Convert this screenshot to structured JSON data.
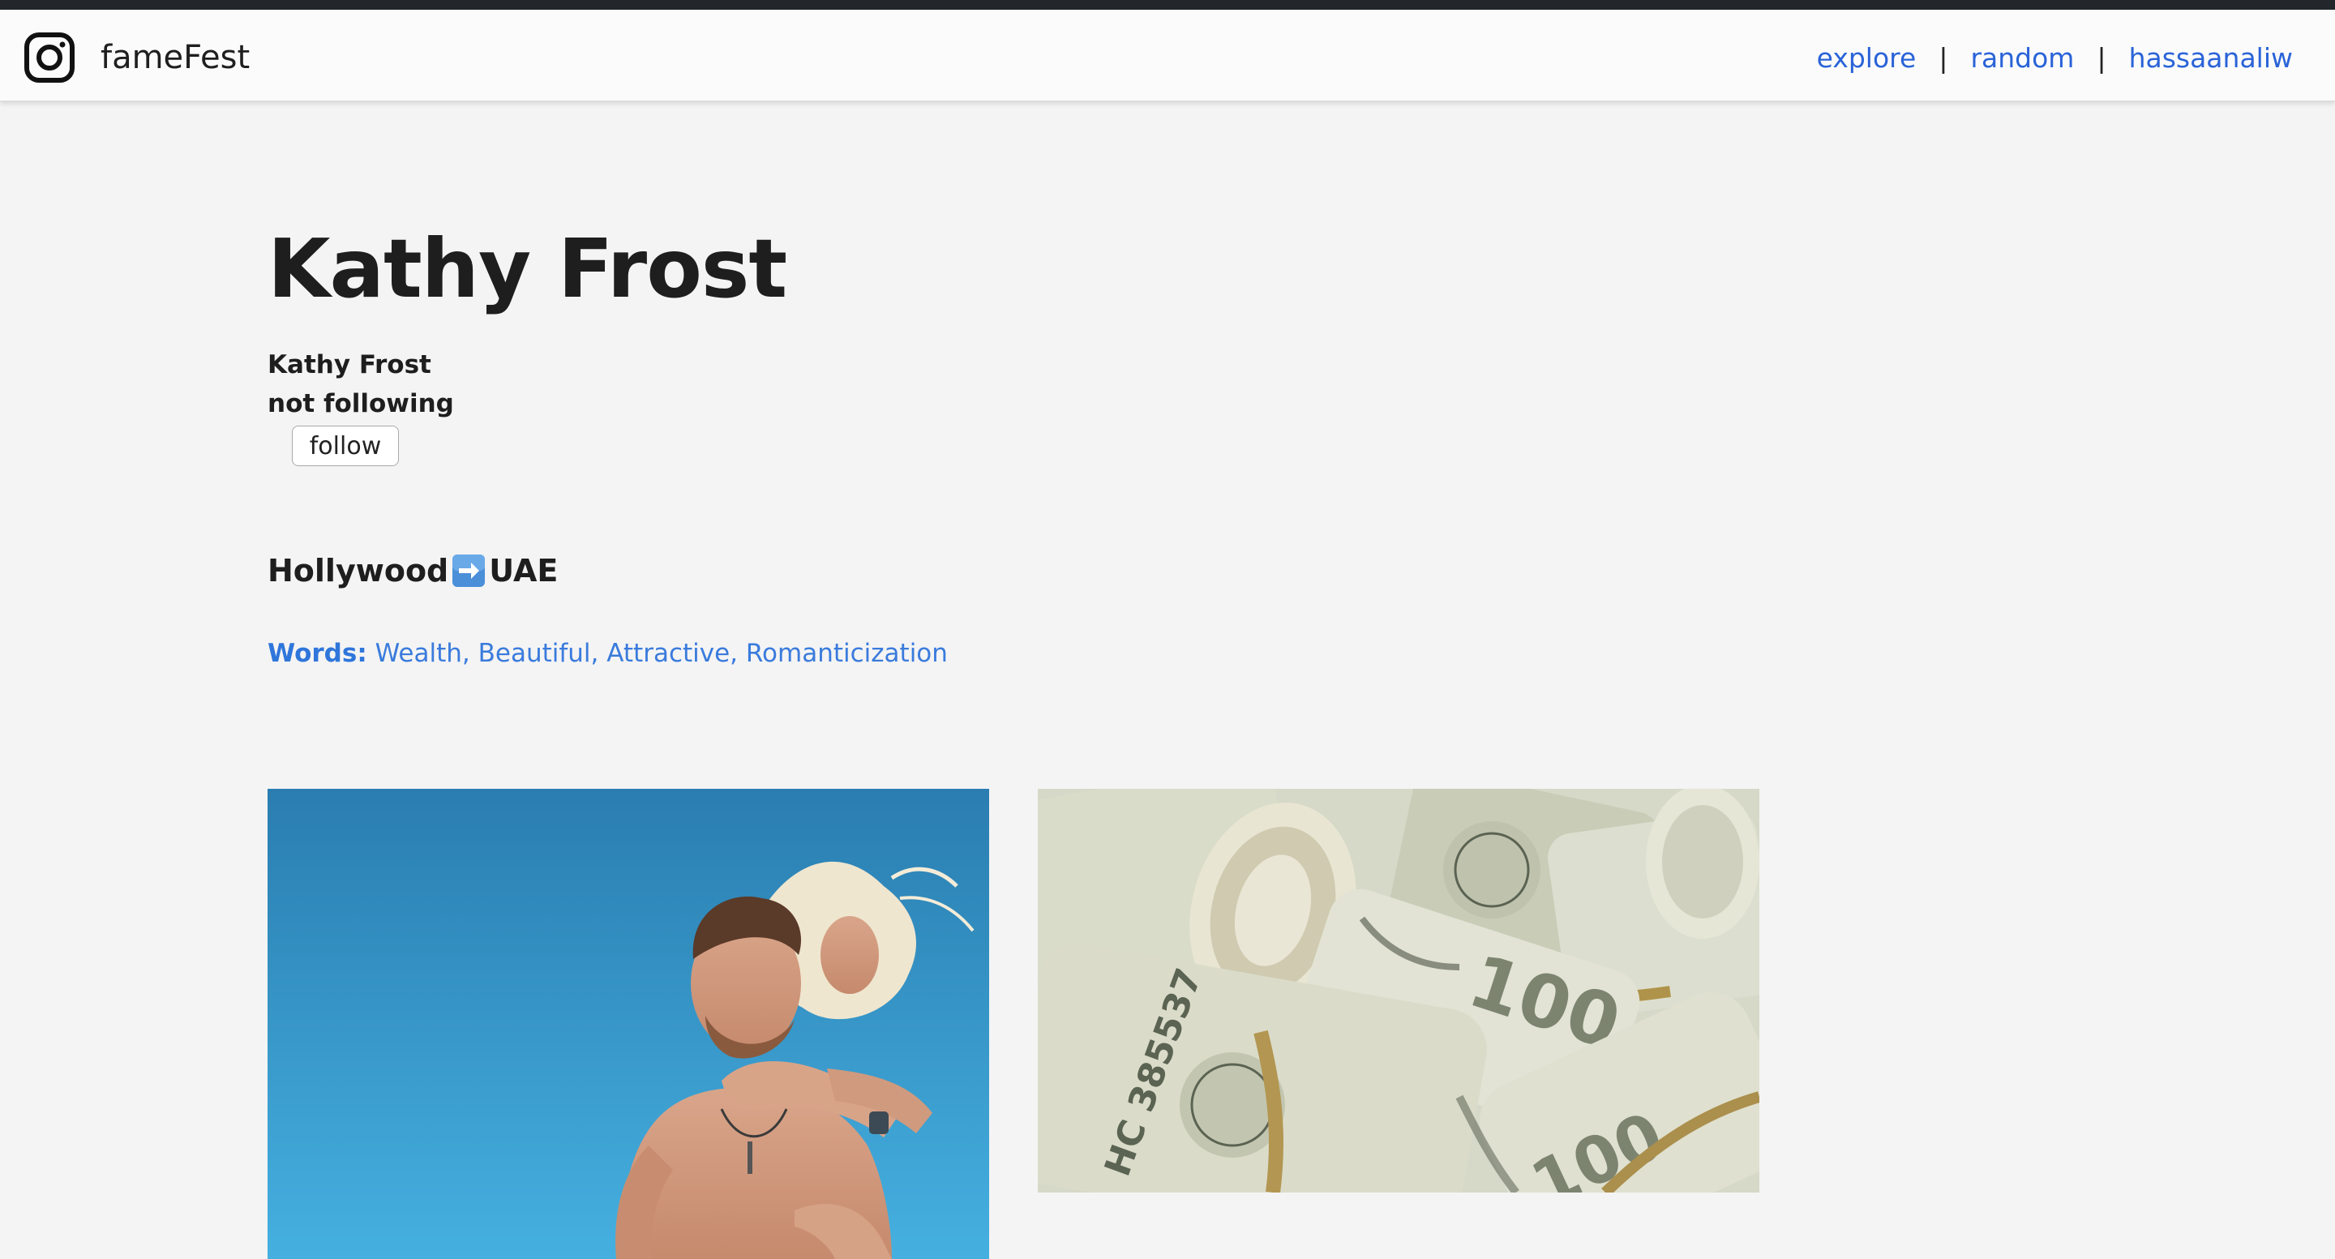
{
  "app": {
    "name": "fameFest",
    "logo_icon": "instagram-camera-icon"
  },
  "nav": {
    "links": [
      {
        "label": "explore"
      },
      {
        "label": "random"
      },
      {
        "label": "hassaanaliw"
      }
    ],
    "separator": "|"
  },
  "profile": {
    "title": "Kathy Frost",
    "name": "Kathy Frost",
    "follow_status": "not following",
    "follow_button_label": "follow",
    "bio_prefix": "Hollywood",
    "bio_icon": "right-arrow-emoji-icon",
    "bio_suffix": "UAE",
    "words_label": "Words:",
    "words_list": "Wealth, Beautiful, Attractive, Romanticization"
  },
  "posts": [
    {
      "subject": "couple-piggyback-photo"
    },
    {
      "subject": "rolled-dollar-bills-photo"
    }
  ],
  "colors": {
    "link": "#2a63d8",
    "words": "#3a7bdc",
    "background": "#f4f4f4",
    "navbar": "#fbfbfb"
  }
}
